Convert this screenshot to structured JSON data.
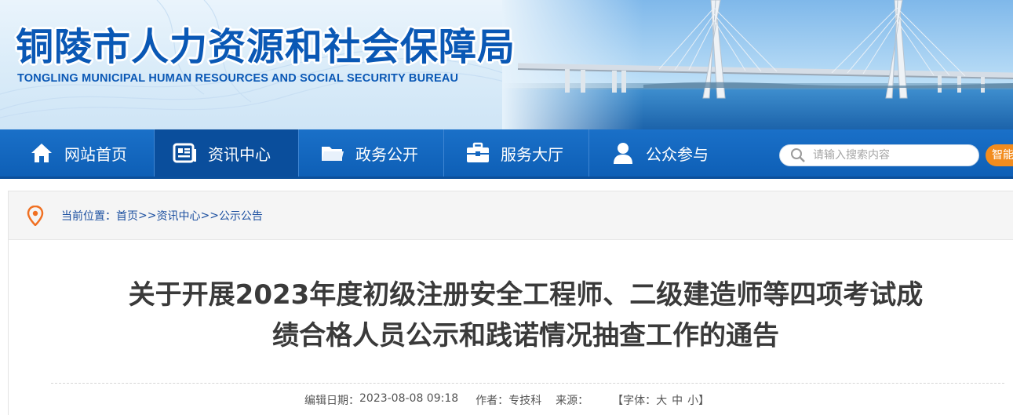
{
  "header": {
    "title_cn": "铜陵市人力资源和社会保障局",
    "title_en": "TONGLING MUNICIPAL HUMAN RESOURCES AND SOCIAL SECURITY BUREAU"
  },
  "nav": {
    "items": [
      {
        "label": "网站首页",
        "icon": "home-icon"
      },
      {
        "label": "资讯中心",
        "icon": "news-icon"
      },
      {
        "label": "政务公开",
        "icon": "folder-icon"
      },
      {
        "label": "服务大厅",
        "icon": "briefcase-icon"
      },
      {
        "label": "公众参与",
        "icon": "user-icon"
      }
    ],
    "active_index": 1,
    "search_placeholder": "请输入搜索内容",
    "smart_label": "智能"
  },
  "breadcrumb": {
    "prefix": "当前位置：",
    "items": [
      "首页",
      "资讯中心",
      "公示公告"
    ],
    "separator": ">>"
  },
  "article": {
    "title_line1": "关于开展2023年度初级注册安全工程师、二级建造师等四项考试成",
    "title_line2": "绩合格人员公示和践诺情况抽查工作的通告",
    "meta": {
      "date_label": "编辑日期：",
      "date": "2023-08-08 09:18",
      "author_label": "作者：",
      "author": "专技科",
      "source_label": "来源：",
      "source": "",
      "font_label": "【字体：",
      "font_large": "大",
      "font_medium": "中",
      "font_small": "小",
      "font_close": "】"
    }
  },
  "colors": {
    "brand_blue": "#0a58b5",
    "nav_blue": "#1466bf",
    "nav_active": "#0a4e9c",
    "accent_orange": "#f28c1e"
  }
}
